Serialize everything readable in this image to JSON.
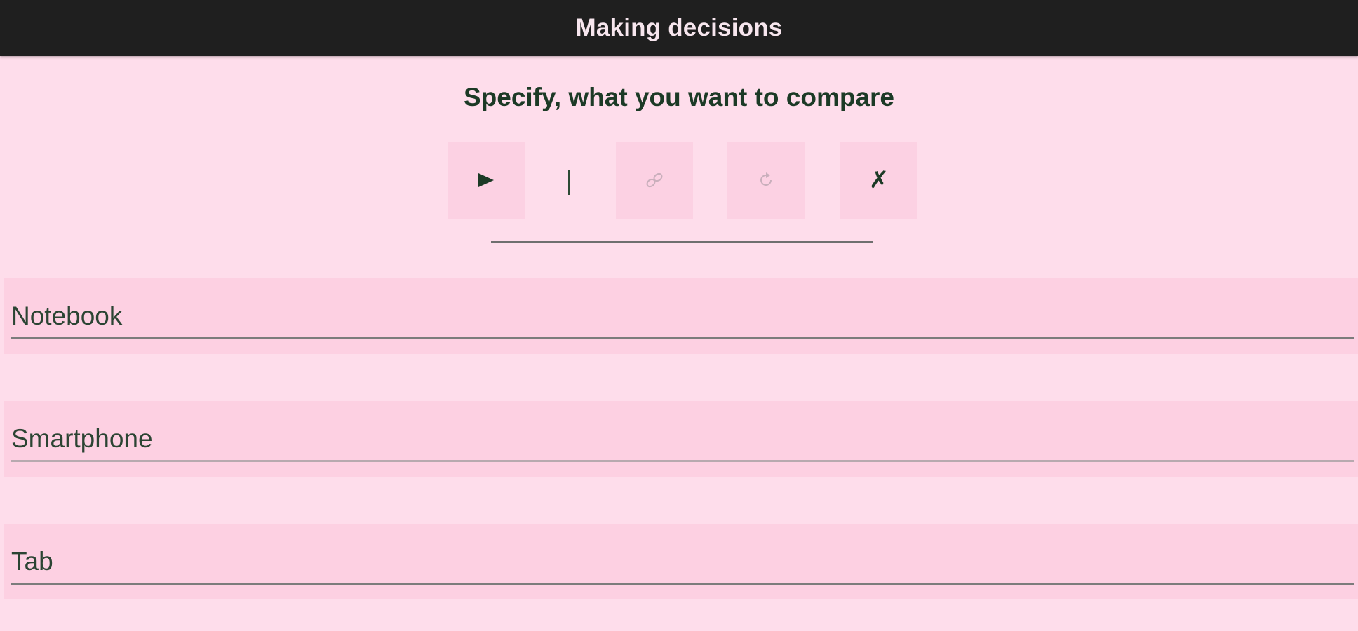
{
  "app_bar": {
    "title": "Making decisions"
  },
  "header": {
    "subtitle": "Specify, what you want to compare"
  },
  "toolbar": {
    "buttons": [
      {
        "icon": "play-icon",
        "enabled": true
      },
      {
        "icon": "link-icon",
        "enabled": false
      },
      {
        "icon": "refresh-icon",
        "enabled": false
      },
      {
        "icon": "close-icon",
        "enabled": true
      }
    ],
    "close_glyph": "✗"
  },
  "fields": [
    {
      "value": "Notebook",
      "placeholder": ""
    },
    {
      "value": "Smartphone",
      "placeholder": ""
    },
    {
      "value": "Tab",
      "placeholder": ""
    }
  ],
  "colors": {
    "background": "#FEDDEB",
    "app_bar": "#1F1F1F",
    "field_background": "#FDD0E2",
    "button_background": "#FCD1E3",
    "text": "#1C3A26",
    "icon_enabled": "#1C3A26",
    "icon_disabled": "#C9AFBC"
  }
}
